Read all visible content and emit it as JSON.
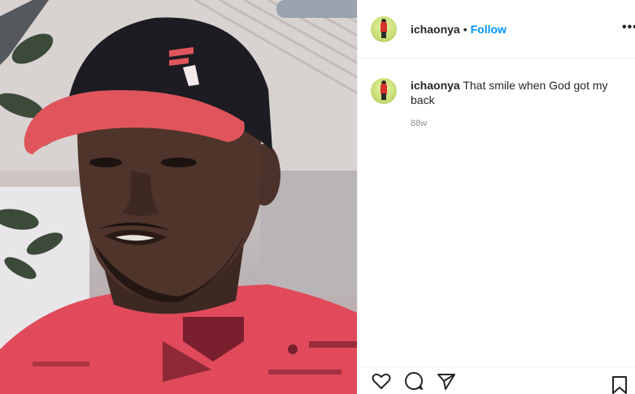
{
  "post": {
    "photo": {
      "hat_logo_icon": "fila-style-logo",
      "colors": {
        "cap_brim": "#e0555c",
        "cap_crown": "#1c1c22",
        "shirt": "#e0485a",
        "skin": "#4a3129",
        "background": "#d6cfcc"
      }
    },
    "header": {
      "username": "ichaonya",
      "separator": "•",
      "follow_label": "Follow",
      "more_icon": "more-horizontal-icon"
    },
    "caption": {
      "username": "ichaonya",
      "text": "That smile when God got my back",
      "time": "88w"
    },
    "actions": {
      "like_icon": "heart-icon",
      "comment_icon": "comment-icon",
      "share_icon": "paper-plane-icon",
      "save_icon": "bookmark-icon"
    },
    "colors": {
      "accent": "#0095f6",
      "text": "#262626",
      "muted": "#8e8e8e",
      "border": "#efefef"
    }
  }
}
